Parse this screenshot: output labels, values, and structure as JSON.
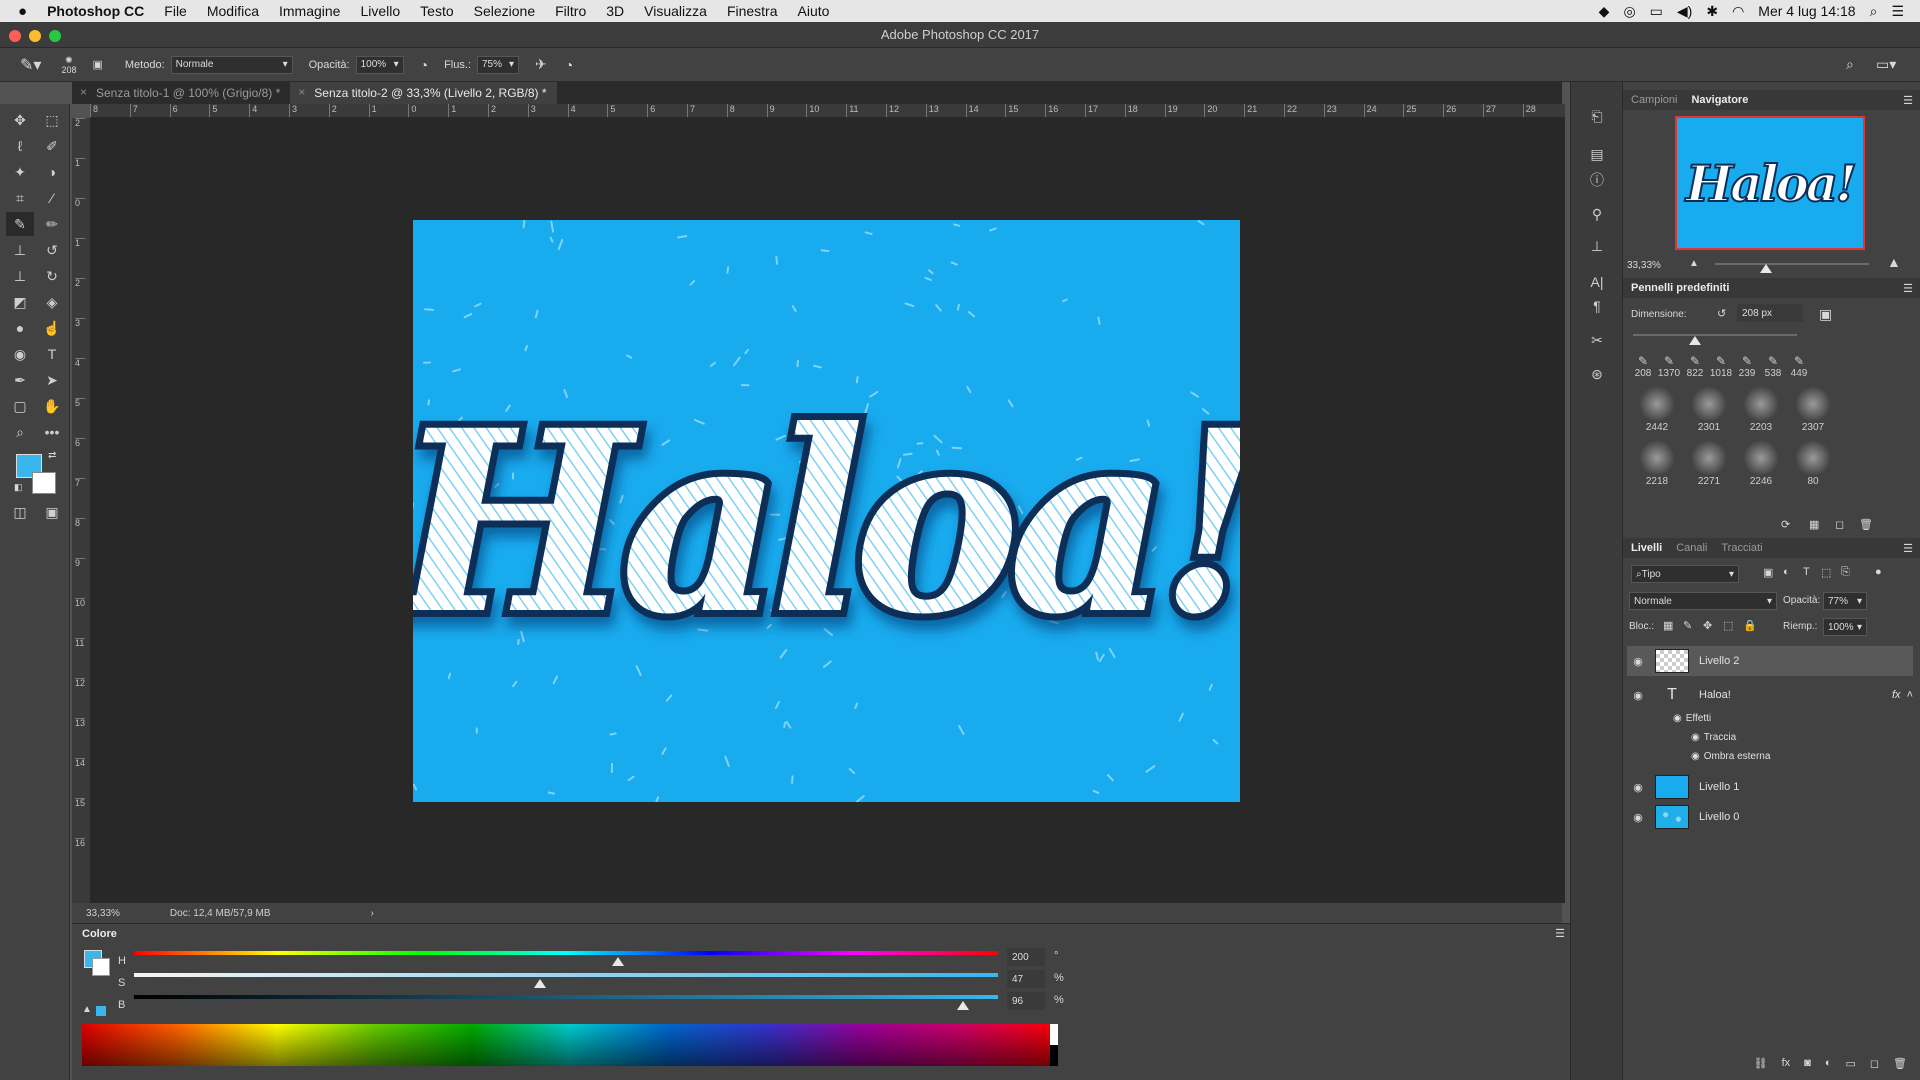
{
  "menubar": {
    "apple": "",
    "app": "Photoshop CC",
    "items": [
      "File",
      "Modifica",
      "Immagine",
      "Livello",
      "Testo",
      "Selezione",
      "Filtro",
      "3D",
      "Visualizza",
      "Finestra",
      "Aiuto"
    ],
    "clock": "Mer 4 lug  14:18"
  },
  "window": {
    "title": "Adobe Photoshop CC 2017"
  },
  "options": {
    "brush_size": "208",
    "mode_label": "Metodo:",
    "mode_value": "Normale",
    "opacity_label": "Opacità:",
    "opacity_value": "100%",
    "flow_label": "Flus.:",
    "flow_value": "75%"
  },
  "tabs": [
    {
      "label": "Senza titolo-1 @ 100% (Grigio/8) *"
    },
    {
      "label": "Senza titolo-2 @ 33,3% (Livello 2, RGB/8) *"
    }
  ],
  "ruler": {
    "h": [
      "8",
      "7",
      "6",
      "5",
      "4",
      "3",
      "2",
      "1",
      "0",
      "1",
      "2",
      "3",
      "4",
      "5",
      "6",
      "7",
      "8",
      "9",
      "10",
      "11",
      "12",
      "13",
      "14",
      "15",
      "16",
      "17",
      "18",
      "19",
      "20",
      "21",
      "22",
      "23",
      "24",
      "25",
      "26",
      "27",
      "28"
    ],
    "v": [
      "2",
      "1",
      "0",
      "1",
      "2",
      "3",
      "4",
      "5",
      "6",
      "7",
      "8",
      "9",
      "10",
      "11",
      "12",
      "13",
      "14",
      "15",
      "16"
    ]
  },
  "canvas": {
    "artwork_text": "Haloa!",
    "bg_color": "#18abee"
  },
  "status": {
    "zoom": "33,33%",
    "doc": "Doc: 12,4 MB/57,9 MB",
    "arrow": "›"
  },
  "color_panel": {
    "title": "Colore",
    "h_label": "H",
    "s_label": "S",
    "b_label": "B",
    "h_value": "200",
    "s_value": "47",
    "b_value": "96",
    "h_unit": "°",
    "s_unit": "%",
    "b_unit": "%",
    "h_level": 0.56,
    "s_level": 0.47,
    "b_level": 0.96,
    "fg_color": "#38b6ee",
    "bg_color": "#ffffff"
  },
  "navigator": {
    "tabs": [
      "Campioni",
      "Navigatore"
    ],
    "zoom": "33,33%",
    "zoom_level": 0.33,
    "preview_text": "Haloa!"
  },
  "brushes": {
    "title": "Pennelli predefiniti",
    "size_label": "Dimensione:",
    "size_value": "208 px",
    "size_level": 0.38,
    "row1": [
      "208",
      "1370",
      "822",
      "1018",
      "239",
      "538",
      "449"
    ],
    "row2": [
      "2442",
      "2301",
      "2203",
      "2307"
    ],
    "row3": [
      "2218",
      "2271",
      "2246",
      "80"
    ]
  },
  "layers": {
    "tabs": [
      "Livelli",
      "Canali",
      "Tracciati"
    ],
    "filter": "Tipo",
    "blend": "Normale",
    "opacity_label": "Opacità:",
    "opacity_value": "77%",
    "lock_label": "Bloc.:",
    "fill_label": "Riemp.:",
    "fill_value": "100%",
    "items": [
      {
        "name": "Livello 2"
      },
      {
        "name": "Haloa!",
        "fx": "fx"
      },
      {
        "name": "Effetti"
      },
      {
        "name": "Traccia"
      },
      {
        "name": "Ombra esterna"
      },
      {
        "name": "Livello 1"
      },
      {
        "name": "Livello 0"
      }
    ]
  }
}
